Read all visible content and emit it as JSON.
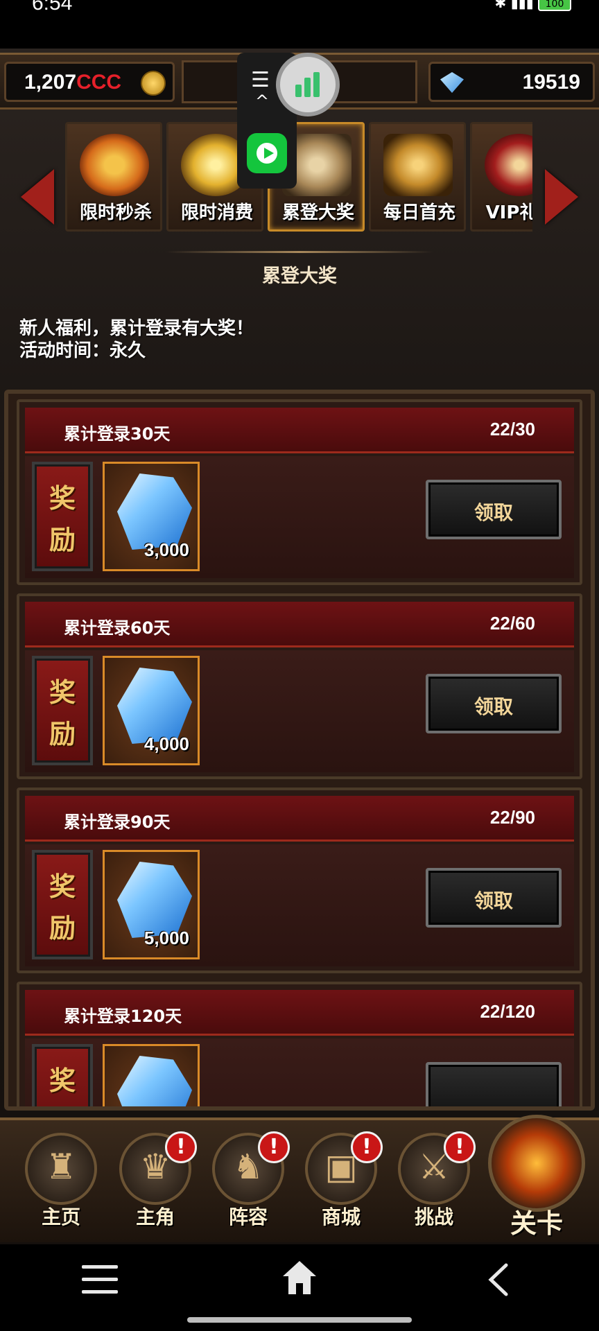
{
  "status_bar": {
    "time": "6:54",
    "battery": "100"
  },
  "resources": {
    "gold_value": "1,207",
    "gold_suffix": "CCC",
    "diamond_value": "19519"
  },
  "tabs": [
    {
      "label": "限时秒杀",
      "icon": "stopwatch-icon",
      "color": "#d56a1a"
    },
    {
      "label": "限时消费",
      "icon": "gold-coins-icon",
      "color": "#e3b12e"
    },
    {
      "label": "累登大奖",
      "icon": "scroll-ticket-icon",
      "color": "#a88757",
      "active": true
    },
    {
      "label": "每日首充",
      "icon": "treasure-chest-icon",
      "color": "#c48a2a"
    },
    {
      "label": "VIP礼包",
      "icon": "vip-badge-icon",
      "color": "#a21d1d"
    }
  ],
  "activity": {
    "title": "累登大奖",
    "desc_line1": "新人福利，累计登录有大奖！",
    "desc_line2": "活动时间：永久"
  },
  "rewards": [
    {
      "name": "累计登录30天",
      "progress": "22/30",
      "tag_top": "奖",
      "tag_bottom": "励",
      "item_icon": "diamond-icon",
      "quantity": "3,000",
      "button": "领取"
    },
    {
      "name": "累计登录60天",
      "progress": "22/60",
      "tag_top": "奖",
      "tag_bottom": "励",
      "item_icon": "diamond-icon",
      "quantity": "4,000",
      "button": "领取"
    },
    {
      "name": "累计登录90天",
      "progress": "22/90",
      "tag_top": "奖",
      "tag_bottom": "励",
      "item_icon": "diamond-icon",
      "quantity": "5,000",
      "button": "领取"
    },
    {
      "name": "累计登录120天",
      "progress": "22/120",
      "tag_top": "奖",
      "tag_bottom": "励",
      "item_icon": "diamond-icon",
      "quantity": "",
      "button": ""
    }
  ],
  "bottom_nav": [
    {
      "label": "主页",
      "icon": "castle-icon",
      "badge": ""
    },
    {
      "label": "主角",
      "icon": "hero-portrait-icon",
      "badge": "!"
    },
    {
      "label": "阵容",
      "icon": "helmet-icon",
      "badge": "!"
    },
    {
      "label": "商城",
      "icon": "treasure-chest-icon",
      "badge": "!"
    },
    {
      "label": "挑战",
      "icon": "crossed-weapons-icon",
      "badge": "!"
    }
  ],
  "stage_button": {
    "label": "关卡",
    "icon": "flame-emblem-icon"
  }
}
